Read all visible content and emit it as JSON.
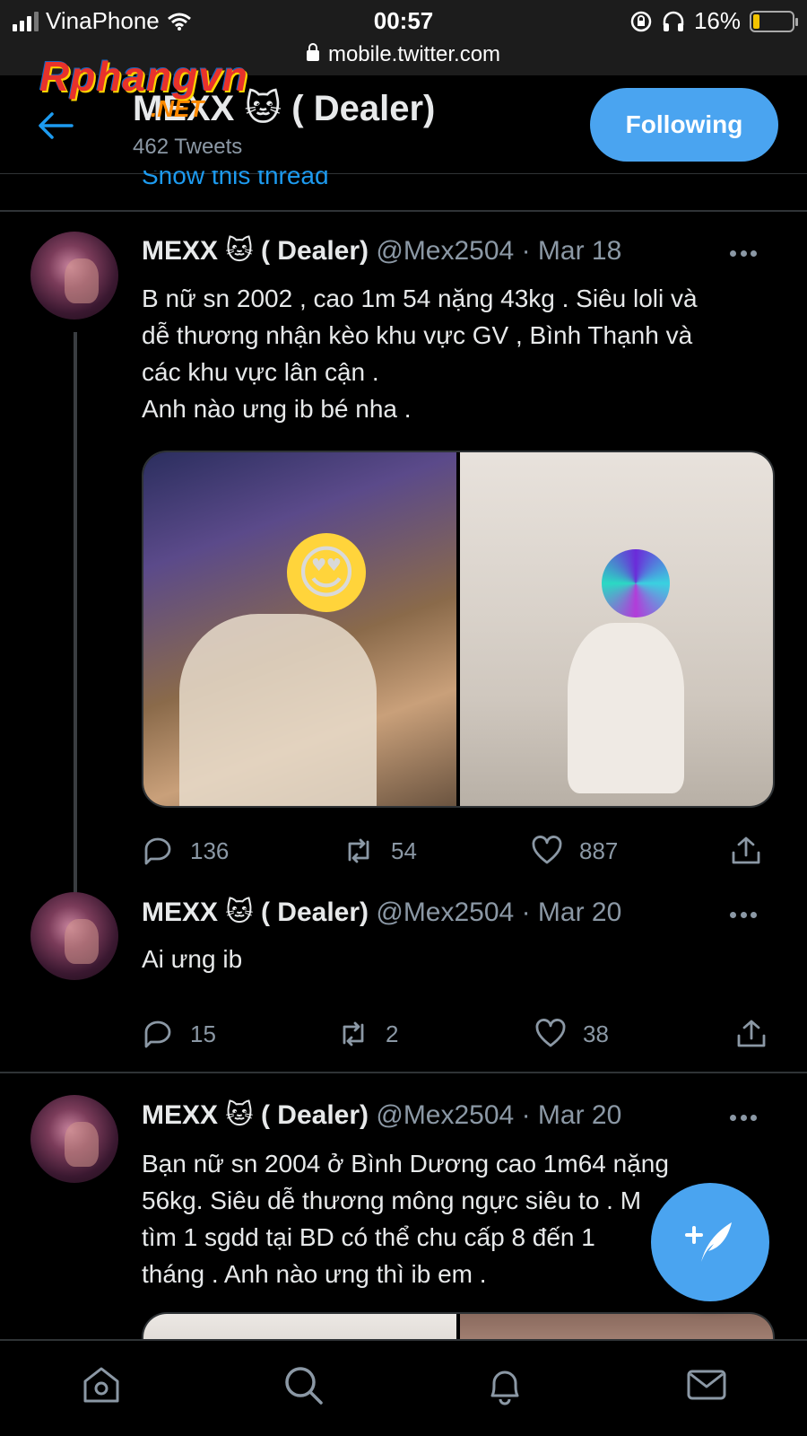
{
  "status_bar": {
    "carrier": "VinaPhone",
    "time": "00:57",
    "battery": "16%",
    "battery_level": 0.16
  },
  "browser": {
    "url": "mobile.twitter.com"
  },
  "watermark": {
    "text": "Rphangvn",
    "sub": ".NET"
  },
  "header": {
    "title": "MEXX 🐱 ( Dealer)",
    "tweet_count": "462 Tweets",
    "follow_label": "Following"
  },
  "show_thread": "Show this thread",
  "tweets": [
    {
      "name": "MEXX 🐱 ( Dealer)",
      "handle": "@Mex2504",
      "date": "Mar 18",
      "text": "B nữ sn 2002 , cao 1m 54 nặng 43kg . Siêu loli và\ndễ thương nhận kèo khu vực GV , Bình Thạnh và\ncác khu vực lân cận .\nAnh nào ưng ib bé nha .",
      "replies": "136",
      "retweets": "54",
      "likes": "887"
    },
    {
      "name": "MEXX 🐱 ( Dealer)",
      "handle": "@Mex2504",
      "date": "Mar 20",
      "text": "Ai ưng ib",
      "replies": "15",
      "retweets": "2",
      "likes": "38"
    },
    {
      "name": "MEXX 🐱 ( Dealer)",
      "handle": "@Mex2504",
      "date": "Mar 20",
      "text": "Bạn nữ sn 2004  ở Bình Dương cao 1m64 nặng\n56kg. Siêu dễ thương mông ngực siêu to . M\ntìm 1 sgdd tại BD có thể chu cấp 8 đến 1\ntháng . Anh nào ưng thì ib em ."
    }
  ],
  "icons": {
    "back": "arrow-left-icon",
    "reply": "reply-icon",
    "retweet": "retweet-icon",
    "like": "heart-icon",
    "share": "share-icon",
    "compose": "compose-tweet-icon",
    "nav": [
      "home-icon",
      "search-icon",
      "notifications-icon",
      "messages-icon"
    ]
  },
  "colors": {
    "accent": "#4aa4f0",
    "link": "#1d9bf0",
    "muted": "#8b98a5",
    "background": "#000000"
  }
}
